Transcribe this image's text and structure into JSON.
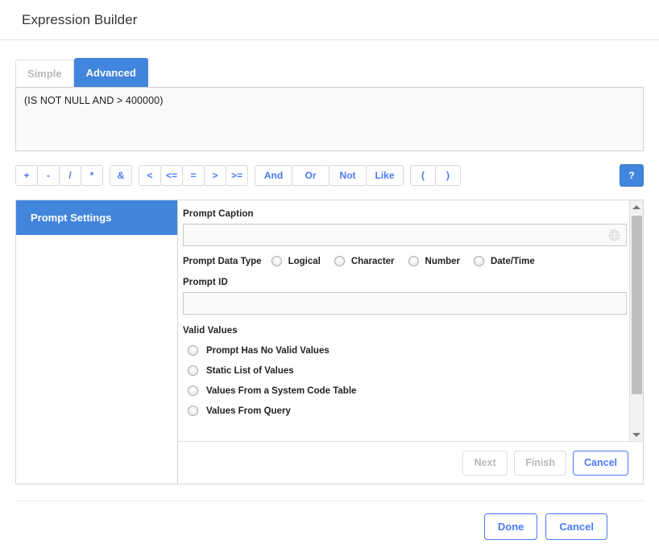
{
  "window": {
    "title": "Expression Builder"
  },
  "tabs": [
    {
      "label": "Simple",
      "active": false
    },
    {
      "label": "Advanced",
      "active": true
    }
  ],
  "expression": {
    "value": "(IS NOT NULL AND > 400000)"
  },
  "operator_bar": {
    "arithmetic": [
      "+",
      "-",
      "/",
      "*"
    ],
    "concat": [
      "&"
    ],
    "comparison": [
      "<",
      "<=",
      "=",
      ">",
      ">="
    ],
    "logical": [
      "And",
      "Or",
      "Not",
      "Like"
    ],
    "parens": [
      "(",
      ")"
    ],
    "help_label": "?"
  },
  "wizard": {
    "nav_items": [
      {
        "label": "Prompt Settings",
        "active": true
      }
    ],
    "form": {
      "prompt_caption": {
        "label": "Prompt Caption",
        "value": "",
        "placeholder": "",
        "icon": "globe-icon"
      },
      "prompt_data_type": {
        "label": "Prompt Data Type",
        "options": [
          {
            "label": "Logical",
            "selected": false
          },
          {
            "label": "Character",
            "selected": false
          },
          {
            "label": "Number",
            "selected": false
          },
          {
            "label": "Date/Time",
            "selected": false
          }
        ]
      },
      "prompt_id": {
        "label": "Prompt ID",
        "value": "",
        "placeholder": ""
      },
      "valid_values": {
        "label": "Valid Values",
        "options": [
          {
            "label": "Prompt Has No Valid Values",
            "selected": false
          },
          {
            "label": "Static List of Values",
            "selected": false
          },
          {
            "label": "Values From a System Code Table",
            "selected": false
          },
          {
            "label": "Values From Query",
            "selected": false
          }
        ]
      }
    },
    "footer_buttons": [
      {
        "label": "Next",
        "state": "disabled"
      },
      {
        "label": "Finish",
        "state": "disabled"
      },
      {
        "label": "Cancel",
        "state": "enabled"
      }
    ]
  },
  "dialog_footer": {
    "buttons": [
      {
        "label": "Done"
      },
      {
        "label": "Cancel"
      }
    ]
  },
  "colors": {
    "accent_blue": "#4285dd",
    "link_blue": "#4a7af5",
    "border_gray": "#d4d4d4",
    "disabled_gray": "#b9b9b9"
  }
}
